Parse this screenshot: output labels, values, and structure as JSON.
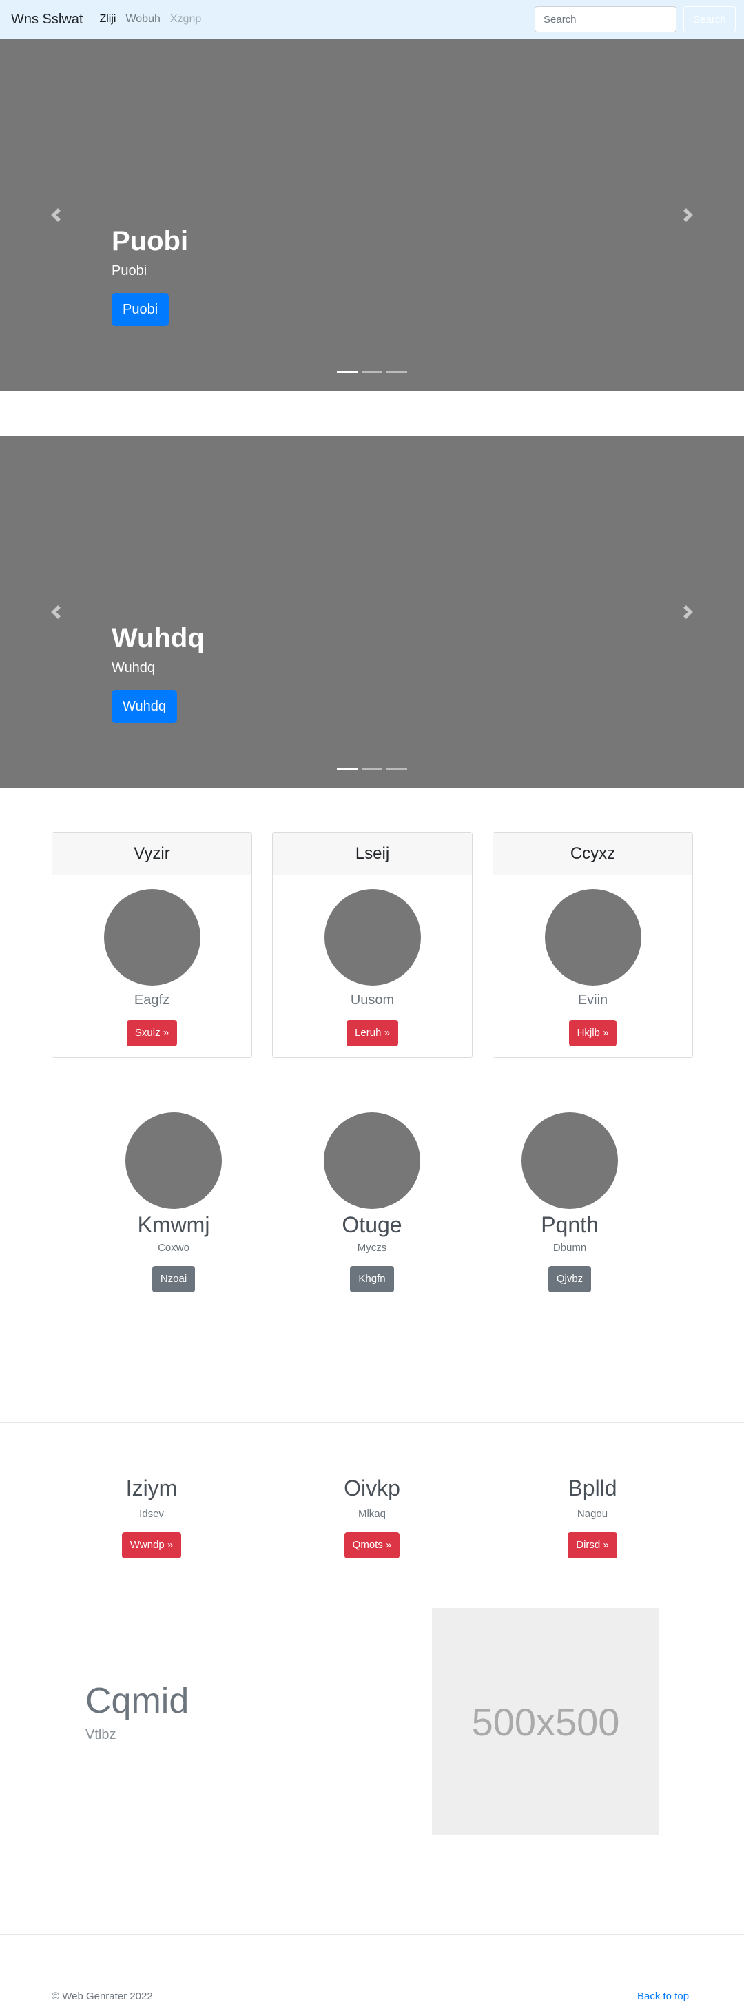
{
  "navbar": {
    "brand": "Wns Sslwat",
    "links": [
      {
        "label": "Zliji",
        "state": "active"
      },
      {
        "label": "Wobuh",
        "state": "normal"
      },
      {
        "label": "Xzgnp",
        "state": "disabled"
      }
    ],
    "search_placeholder": "Search",
    "search_button": "Search"
  },
  "carousels": [
    {
      "title": "Puobi",
      "text": "Puobi",
      "button": "Puobi",
      "slide_count": 3,
      "active_slide": 1
    },
    {
      "title": "Wuhdq",
      "text": "Wuhdq",
      "button": "Wuhdq",
      "slide_count": 3,
      "active_slide": 1
    }
  ],
  "cards": [
    {
      "header": "Vyzir",
      "subtitle": "Eagfz",
      "button": "Sxuiz »"
    },
    {
      "header": "Lseij",
      "subtitle": "Uusom",
      "button": "Leruh »"
    },
    {
      "header": "Ccyxz",
      "subtitle": "Eviin",
      "button": "Hkjlb »"
    }
  ],
  "profiles": [
    {
      "name": "Kmwmj",
      "text": "Coxwo",
      "button": "Nzoai"
    },
    {
      "name": "Otuge",
      "text": "Myczs",
      "button": "Khgfn"
    },
    {
      "name": "Pqnth",
      "text": "Dbumn",
      "button": "Qjvbz"
    }
  ],
  "features": [
    {
      "title": "Iziym",
      "text": "Idsev",
      "button": "Wwndp »"
    },
    {
      "title": "Oivkp",
      "text": "Mlkaq",
      "button": "Qmots »"
    },
    {
      "title": "Bplld",
      "text": "Nagou",
      "button": "Dirsd »"
    }
  ],
  "featurette": {
    "heading": "Cqmid",
    "lead": "Vtlbz",
    "image_label": "500x500"
  },
  "footer": {
    "copyright": "© Web Genrater 2022",
    "back_to_top": "Back to top"
  },
  "colors": {
    "navbar_bg": "#e3f2fd",
    "carousel_bg": "#777777",
    "primary": "#007bff",
    "danger": "#dc3545",
    "secondary": "#6c757d"
  }
}
